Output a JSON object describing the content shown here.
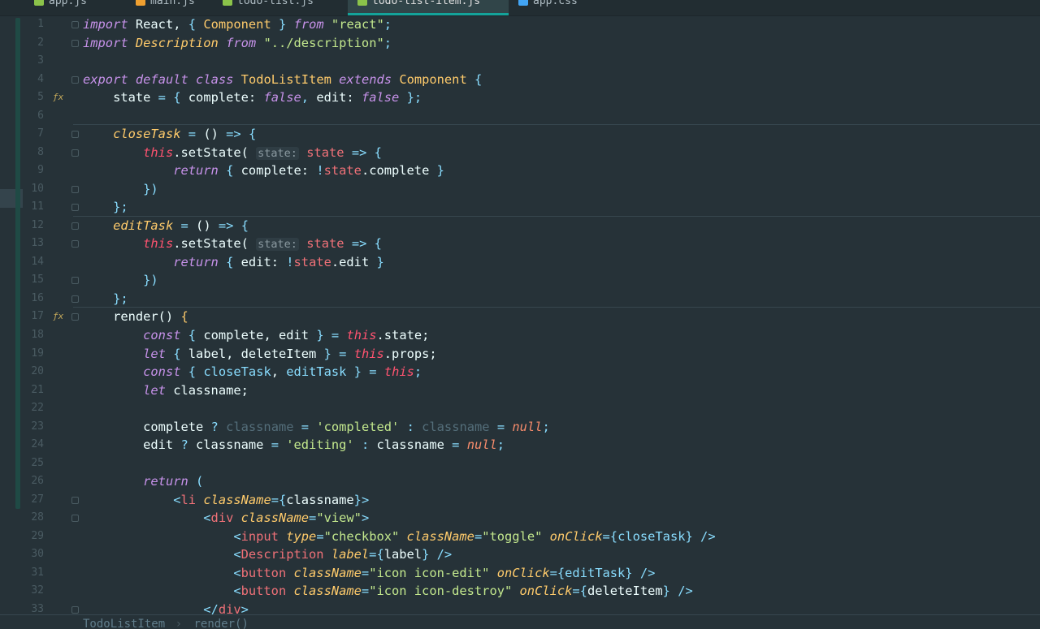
{
  "tabs": [
    {
      "label": "app.js",
      "color": "#8bc34a"
    },
    {
      "label": "main.js",
      "color": "#f0a030"
    },
    {
      "label": "todo-list.js",
      "color": "#8bc34a"
    },
    {
      "label": "todo-list-item.js",
      "color": "#8bc34a",
      "active": true
    },
    {
      "label": "app.css",
      "color": "#42a5f5"
    }
  ],
  "breadcrumb": {
    "class": "TodoListItem",
    "sep": "›",
    "method": "render()"
  },
  "lines": [
    {
      "n": "1",
      "t": [
        [
          "k",
          "import"
        ],
        [
          "",
          " React, "
        ],
        [
          "p",
          "{"
        ],
        [
          "",
          " "
        ],
        [
          "c",
          "Component"
        ],
        [
          "",
          " "
        ],
        [
          "p",
          "}"
        ],
        [
          "",
          " "
        ],
        [
          "k",
          "from"
        ],
        [
          "",
          " "
        ],
        [
          "s",
          "\"react\""
        ],
        [
          "p",
          ";"
        ]
      ]
    },
    {
      "n": "2",
      "t": [
        [
          "k",
          "import"
        ],
        [
          "",
          " "
        ],
        [
          "ci",
          "Description"
        ],
        [
          "",
          " "
        ],
        [
          "k",
          "from"
        ],
        [
          "",
          " "
        ],
        [
          "s",
          "\"../description\""
        ],
        [
          "p",
          ";"
        ]
      ]
    },
    {
      "n": "3",
      "t": []
    },
    {
      "n": "4",
      "t": [
        [
          "k",
          "export"
        ],
        [
          "",
          " "
        ],
        [
          "k",
          "default"
        ],
        [
          "",
          " "
        ],
        [
          "k",
          "class"
        ],
        [
          "",
          " "
        ],
        [
          "c",
          "TodoListItem"
        ],
        [
          "",
          " "
        ],
        [
          "k",
          "extends"
        ],
        [
          "",
          " "
        ],
        [
          "c",
          "Component"
        ],
        [
          "",
          " "
        ],
        [
          "p",
          "{"
        ]
      ]
    },
    {
      "n": "5",
      "t": [
        [
          "",
          "    state "
        ],
        [
          "p",
          "="
        ],
        [
          "",
          " "
        ],
        [
          "p",
          "{"
        ],
        [
          "",
          " complete: "
        ],
        [
          "b",
          "false"
        ],
        [
          "p",
          ","
        ],
        [
          "",
          " edit: "
        ],
        [
          "b",
          "false"
        ],
        [
          "",
          " "
        ],
        [
          "p",
          "}"
        ],
        [
          "p",
          ";"
        ]
      ]
    },
    {
      "n": "6",
      "t": []
    },
    {
      "n": "7",
      "t": [
        [
          "",
          "    "
        ],
        [
          "f",
          "closeTask"
        ],
        [
          "",
          " "
        ],
        [
          "p",
          "="
        ],
        [
          "",
          " () "
        ],
        [
          "p",
          "=>"
        ],
        [
          "",
          " "
        ],
        [
          "p",
          "{"
        ]
      ]
    },
    {
      "n": "8",
      "t": [
        [
          "",
          "        "
        ],
        [
          "t",
          "this"
        ],
        [
          "",
          ".setState( "
        ],
        [
          "h",
          "state:"
        ],
        [
          "",
          " "
        ],
        [
          "r",
          "state"
        ],
        [
          "",
          " "
        ],
        [
          "p",
          "=>"
        ],
        [
          "",
          " "
        ],
        [
          "p",
          "{"
        ]
      ]
    },
    {
      "n": "9",
      "t": [
        [
          "",
          "            "
        ],
        [
          "k",
          "return"
        ],
        [
          "",
          " "
        ],
        [
          "p",
          "{"
        ],
        [
          "",
          " complete: "
        ],
        [
          "p",
          "!"
        ],
        [
          "r",
          "state"
        ],
        [
          "",
          ".complete "
        ],
        [
          "p",
          "}"
        ]
      ]
    },
    {
      "n": "10",
      "t": [
        [
          "",
          "        "
        ],
        [
          "p",
          "})"
        ]
      ]
    },
    {
      "n": "11",
      "t": [
        [
          "",
          "    "
        ],
        [
          "p",
          "};"
        ]
      ]
    },
    {
      "n": "12",
      "t": [
        [
          "",
          "    "
        ],
        [
          "f",
          "editTask"
        ],
        [
          "",
          " "
        ],
        [
          "p",
          "="
        ],
        [
          "",
          " () "
        ],
        [
          "p",
          "=>"
        ],
        [
          "",
          " "
        ],
        [
          "p",
          "{"
        ]
      ]
    },
    {
      "n": "13",
      "t": [
        [
          "",
          "        "
        ],
        [
          "t",
          "this"
        ],
        [
          "",
          ".setState( "
        ],
        [
          "h",
          "state:"
        ],
        [
          "",
          " "
        ],
        [
          "r",
          "state"
        ],
        [
          "",
          " "
        ],
        [
          "p",
          "=>"
        ],
        [
          "",
          " "
        ],
        [
          "p",
          "{"
        ]
      ]
    },
    {
      "n": "14",
      "t": [
        [
          "",
          "            "
        ],
        [
          "k",
          "return"
        ],
        [
          "",
          " "
        ],
        [
          "p",
          "{"
        ],
        [
          "",
          " edit: "
        ],
        [
          "p",
          "!"
        ],
        [
          "r",
          "state"
        ],
        [
          "",
          ".edit "
        ],
        [
          "p",
          "}"
        ]
      ]
    },
    {
      "n": "15",
      "t": [
        [
          "",
          "        "
        ],
        [
          "p",
          "})"
        ]
      ]
    },
    {
      "n": "16",
      "t": [
        [
          "",
          "    "
        ],
        [
          "p",
          "};"
        ]
      ]
    },
    {
      "n": "17",
      "t": [
        [
          "",
          "    render() "
        ],
        [
          "c",
          "{"
        ]
      ]
    },
    {
      "n": "18",
      "t": [
        [
          "",
          "        "
        ],
        [
          "k",
          "const"
        ],
        [
          "",
          " "
        ],
        [
          "p",
          "{"
        ],
        [
          "",
          " complete, edit "
        ],
        [
          "p",
          "}"
        ],
        [
          "",
          " "
        ],
        [
          "p",
          "="
        ],
        [
          "",
          " "
        ],
        [
          "t",
          "this"
        ],
        [
          "",
          ".state;"
        ]
      ]
    },
    {
      "n": "19",
      "t": [
        [
          "",
          "        "
        ],
        [
          "k",
          "let"
        ],
        [
          "",
          " "
        ],
        [
          "p",
          "{"
        ],
        [
          "",
          " label, deleteItem "
        ],
        [
          "p",
          "}"
        ],
        [
          "",
          " "
        ],
        [
          "p",
          "="
        ],
        [
          "",
          " "
        ],
        [
          "t",
          "this"
        ],
        [
          "",
          ".props;"
        ]
      ]
    },
    {
      "n": "20",
      "t": [
        [
          "",
          "        "
        ],
        [
          "k",
          "const"
        ],
        [
          "",
          " "
        ],
        [
          "p",
          "{"
        ],
        [
          "",
          " "
        ],
        [
          "p",
          "closeTask"
        ],
        [
          "",
          ", "
        ],
        [
          "p",
          "editTask"
        ],
        [
          "",
          " "
        ],
        [
          "p",
          "}"
        ],
        [
          "",
          " "
        ],
        [
          "p",
          "="
        ],
        [
          "",
          " "
        ],
        [
          "t",
          "this"
        ],
        [
          "p",
          ";"
        ]
      ]
    },
    {
      "n": "21",
      "t": [
        [
          "",
          "        "
        ],
        [
          "k",
          "let"
        ],
        [
          "",
          " classname;"
        ]
      ]
    },
    {
      "n": "22",
      "t": []
    },
    {
      "n": "23",
      "t": [
        [
          "",
          "        complete "
        ],
        [
          "p",
          "?"
        ],
        [
          "",
          " "
        ],
        [
          "g",
          "classname"
        ],
        [
          "",
          " "
        ],
        [
          "p",
          "="
        ],
        [
          "",
          " "
        ],
        [
          "s",
          "'completed'"
        ],
        [
          "",
          " "
        ],
        [
          "p",
          ":"
        ],
        [
          "",
          " "
        ],
        [
          "g",
          "classname"
        ],
        [
          "",
          " "
        ],
        [
          "p",
          "="
        ],
        [
          "",
          " "
        ],
        [
          "n",
          "null"
        ],
        [
          "p",
          ";"
        ]
      ]
    },
    {
      "n": "24",
      "t": [
        [
          "",
          "        edit "
        ],
        [
          "p",
          "?"
        ],
        [
          "",
          " classname "
        ],
        [
          "p",
          "="
        ],
        [
          "",
          " "
        ],
        [
          "s",
          "'editing'"
        ],
        [
          "",
          " "
        ],
        [
          "p",
          ":"
        ],
        [
          "",
          " classname "
        ],
        [
          "p",
          "="
        ],
        [
          "",
          " "
        ],
        [
          "n",
          "null"
        ],
        [
          "p",
          ";"
        ]
      ]
    },
    {
      "n": "25",
      "t": []
    },
    {
      "n": "26",
      "t": [
        [
          "",
          "        "
        ],
        [
          "k",
          "return"
        ],
        [
          "",
          " "
        ],
        [
          "p",
          "("
        ]
      ]
    },
    {
      "n": "27",
      "t": [
        [
          "",
          "            "
        ],
        [
          "p",
          "<"
        ],
        [
          "tg",
          "li"
        ],
        [
          "",
          " "
        ],
        [
          "a",
          "className"
        ],
        [
          "p",
          "={"
        ],
        [
          "",
          "classname"
        ],
        [
          "p",
          "}>"
        ]
      ]
    },
    {
      "n": "28",
      "t": [
        [
          "",
          "                "
        ],
        [
          "p",
          "<"
        ],
        [
          "tg",
          "div"
        ],
        [
          "",
          " "
        ],
        [
          "a",
          "className"
        ],
        [
          "p",
          "="
        ],
        [
          "s",
          "\"view\""
        ],
        [
          "p",
          ">"
        ]
      ]
    },
    {
      "n": "29",
      "t": [
        [
          "",
          "                    "
        ],
        [
          "p",
          "<"
        ],
        [
          "tg",
          "input"
        ],
        [
          "",
          " "
        ],
        [
          "a",
          "type"
        ],
        [
          "p",
          "="
        ],
        [
          "s",
          "\"checkbox\""
        ],
        [
          "",
          " "
        ],
        [
          "a",
          "className"
        ],
        [
          "p",
          "="
        ],
        [
          "s",
          "\"toggle\""
        ],
        [
          "",
          " "
        ],
        [
          "a",
          "onClick"
        ],
        [
          "p",
          "={"
        ],
        [
          "p",
          "closeTask"
        ],
        [
          "p",
          "}"
        ],
        [
          "",
          " "
        ],
        [
          "p",
          "/>"
        ]
      ]
    },
    {
      "n": "30",
      "t": [
        [
          "",
          "                    "
        ],
        [
          "p",
          "<"
        ],
        [
          "tg",
          "Description"
        ],
        [
          "",
          " "
        ],
        [
          "a",
          "label"
        ],
        [
          "p",
          "={"
        ],
        [
          "",
          "label"
        ],
        [
          "p",
          "}"
        ],
        [
          "",
          " "
        ],
        [
          "p",
          "/>"
        ]
      ]
    },
    {
      "n": "31",
      "t": [
        [
          "",
          "                    "
        ],
        [
          "p",
          "<"
        ],
        [
          "tg",
          "button"
        ],
        [
          "",
          " "
        ],
        [
          "a",
          "className"
        ],
        [
          "p",
          "="
        ],
        [
          "s",
          "\"icon icon-edit\""
        ],
        [
          "",
          " "
        ],
        [
          "a",
          "onClick"
        ],
        [
          "p",
          "={"
        ],
        [
          "p",
          "editTask"
        ],
        [
          "p",
          "}"
        ],
        [
          "",
          " "
        ],
        [
          "p",
          "/>"
        ]
      ]
    },
    {
      "n": "32",
      "t": [
        [
          "",
          "                    "
        ],
        [
          "p",
          "<"
        ],
        [
          "tg",
          "button"
        ],
        [
          "",
          " "
        ],
        [
          "a",
          "className"
        ],
        [
          "p",
          "="
        ],
        [
          "s",
          "\"icon icon-destroy\""
        ],
        [
          "",
          " "
        ],
        [
          "a",
          "onClick"
        ],
        [
          "p",
          "={"
        ],
        [
          "",
          "deleteItem"
        ],
        [
          "p",
          "}"
        ],
        [
          "",
          " "
        ],
        [
          "p",
          "/>"
        ]
      ]
    },
    {
      "n": "33",
      "t": [
        [
          "",
          "                "
        ],
        [
          "p",
          "</"
        ],
        [
          "tg",
          "div"
        ],
        [
          "p",
          ">"
        ]
      ]
    }
  ]
}
